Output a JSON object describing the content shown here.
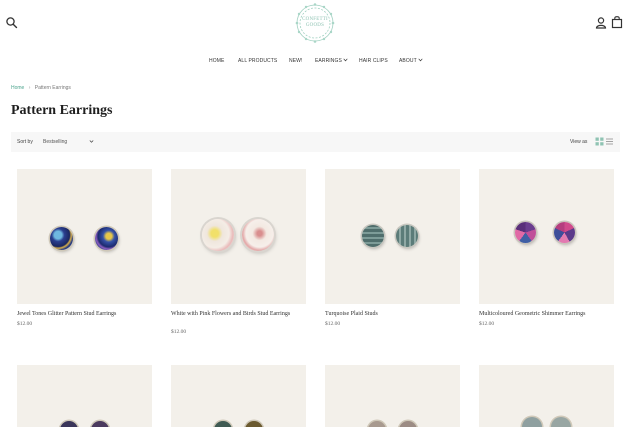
{
  "header": {
    "logo_lines": [
      "CONFETTI",
      "GOODS"
    ],
    "icons": {
      "search": "search-icon",
      "account": "user-icon",
      "cart": "shopping-bag-icon"
    }
  },
  "nav": {
    "items": [
      {
        "label": "HOME"
      },
      {
        "label": "ALL PRODUCTS"
      },
      {
        "label": "NEW!"
      },
      {
        "label": "EARRINGS",
        "dropdown": true
      },
      {
        "label": "HAIR CLIPS"
      },
      {
        "label": "ABOUT",
        "dropdown": true
      }
    ]
  },
  "breadcrumb": {
    "home": "Home",
    "current": "Pattern Earrings"
  },
  "page": {
    "title": "Pattern Earrings"
  },
  "toolbar": {
    "sort_label": "Sort by",
    "sort_value": "Bestselling",
    "view_label": "View as",
    "view_modes": [
      "grid",
      "list"
    ],
    "active_view": "grid"
  },
  "products": [
    {
      "title": "Jewel Tones Glitter Pattern Stud Earrings",
      "price": "$12.00"
    },
    {
      "title": "White with Pink Flowers and Birds Stud Earrings",
      "price": "$12.00"
    },
    {
      "title": "Turquoise Plaid Studs",
      "price": "$12.00"
    },
    {
      "title": "Multicoloured Geometric Shimmer Earrings",
      "price": "$12.00"
    }
  ],
  "colors": {
    "accent": "#4fa58f",
    "logo": "#8fc3b3",
    "toolbar_bg": "#f7f7f7",
    "image_bg": "#f3f0ea"
  }
}
